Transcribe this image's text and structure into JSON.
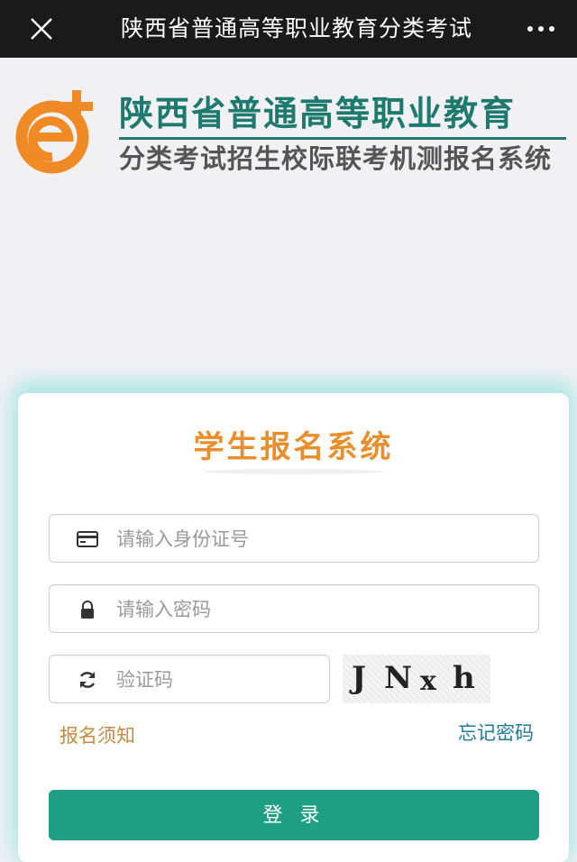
{
  "topbar": {
    "title": "陕西省普通高等职业教育分类考试",
    "close_icon": "close-icon",
    "more_icon": "more-icon"
  },
  "brand": {
    "main": "陕西省普通高等职业教育",
    "sub": "分类考试招生校际联考机测报名系统",
    "logo_icon": "e-plus-logo-icon",
    "color_main": "#1e7a6e",
    "color_logo": "#f08a24"
  },
  "login": {
    "title": "学生报名系统",
    "id_placeholder": "请输入身份证号",
    "password_placeholder": "请输入密码",
    "captcha_placeholder": "验证码",
    "captcha_chars": [
      "J",
      "N",
      "x",
      "h"
    ],
    "notice_link": "报名须知",
    "forgot_link": "忘记密码",
    "login_button": "登 录",
    "accent": "#1e9e82"
  }
}
